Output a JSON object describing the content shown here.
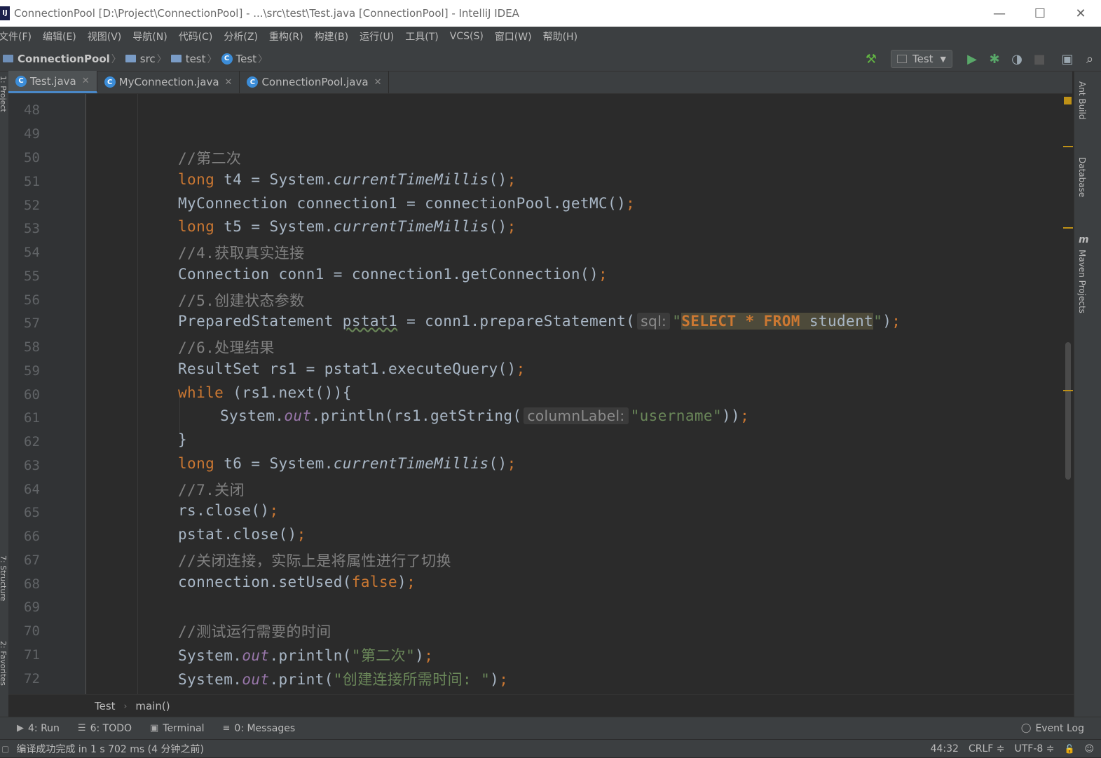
{
  "window": {
    "title": "ConnectionPool [D:\\Project\\ConnectionPool] - ...\\src\\test\\Test.java [ConnectionPool] - IntelliJ IDEA",
    "app_icon_text": "IJ",
    "minimize": "—",
    "maximize": "☐",
    "close": "✕"
  },
  "menu": [
    "文件(F)",
    "编辑(E)",
    "视图(V)",
    "导航(N)",
    "代码(C)",
    "分析(Z)",
    "重构(R)",
    "构建(B)",
    "运行(U)",
    "工具(T)",
    "VCS(S)",
    "窗口(W)",
    "帮助(H)"
  ],
  "navbar": {
    "project": "ConnectionPool",
    "crumbs": [
      "src",
      "test",
      "Test"
    ],
    "run_config": "Test"
  },
  "tabs": [
    {
      "label": "Test.java",
      "active": true
    },
    {
      "label": "MyConnection.java",
      "active": false
    },
    {
      "label": "ConnectionPool.java",
      "active": false
    }
  ],
  "right_tools": [
    "Ant Build",
    "Database",
    "Maven Projects"
  ],
  "left_tools": [
    "1: Project",
    "7: Structure",
    "2: Favorites"
  ],
  "line_numbers": [
    "48",
    "49",
    "50",
    "51",
    "52",
    "53",
    "54",
    "55",
    "56",
    "57",
    "58",
    "59",
    "60",
    "61",
    "62",
    "63",
    "64",
    "65",
    "66",
    "67",
    "68",
    "69",
    "70",
    "71",
    "72"
  ],
  "code": {
    "l50": "//第二次",
    "l51_kw": "long",
    "l51_a": " t4 = System.",
    "l51_m": "currentTimeMillis",
    "l51_b": "()",
    "l52_a": "MyConnection connection1 = connectionPool.getMC()",
    "l53_kw": "long",
    "l53_a": " t5 = System.",
    "l53_m": "currentTimeMillis",
    "l53_b": "()",
    "l54": "//4.获取真实连接",
    "l55_a": "Connection conn1 = connection1.getConnection()",
    "l56": "//5.创建状态参数",
    "l57_a": "PreparedStatement ",
    "l57_var": "pstat1",
    "l57_b": " = conn1.prepareStatement(",
    "l57_hint": "sql:",
    "l57_q1": "\"",
    "l57_k1": "SELECT",
    "l57_star": " * ",
    "l57_k2": "FROM",
    "l57_tbl": " student",
    "l57_q2": "\"",
    "l57_c": ")",
    "l58": "//6.处理结果",
    "l59_a": "ResultSet rs1 = pstat1.executeQuery()",
    "l60_kw": "while",
    "l60_a": " (rs1.next()){",
    "l61_a": "System.",
    "l61_f": "out",
    "l61_b": ".println(rs1.getString(",
    "l61_hint": "columnLabel:",
    "l61_str": "\"username\"",
    "l61_c": "))",
    "l62": "}",
    "l63_kw": "long",
    "l63_a": " t6 = System.",
    "l63_m": "currentTimeMillis",
    "l63_b": "()",
    "l64": "//7.关闭",
    "l65_a": "rs.close()",
    "l66_a": "pstat.close()",
    "l67": "//关闭连接，实际上是将属性进行了切换",
    "l68_a": "connection.setUsed(",
    "l68_kw": "false",
    "l68_b": ")",
    "l70": "//测试运行需要的时间",
    "l71_a": "System.",
    "l71_f": "out",
    "l71_b": ".println(",
    "l71_str": "\"第二次\"",
    "l71_c": ")",
    "l72_a": "System.",
    "l72_f": "out",
    "l72_b": ".print(",
    "l72_str": "\"创建连接所需时间: \"",
    "l72_c": ")",
    "semi": ";"
  },
  "breadcrumb": {
    "class": "Test",
    "method": "main()"
  },
  "toolwindows": [
    {
      "label": "4: Run"
    },
    {
      "label": "6: TODO"
    },
    {
      "label": "Terminal"
    },
    {
      "label": "0: Messages"
    }
  ],
  "event_log": "Event Log",
  "status": {
    "message": "编译成功完成 in 1 s 702 ms (4 分钟之前)",
    "position": "44:32",
    "line_sep": "CRLF ≑",
    "encoding": "UTF-8 ≑"
  },
  "colors": {
    "keyword": "#cc7832",
    "comment": "#808080",
    "string": "#6a8759",
    "field": "#9876aa",
    "text": "#a9b7c6",
    "background": "#2b2b2b"
  }
}
